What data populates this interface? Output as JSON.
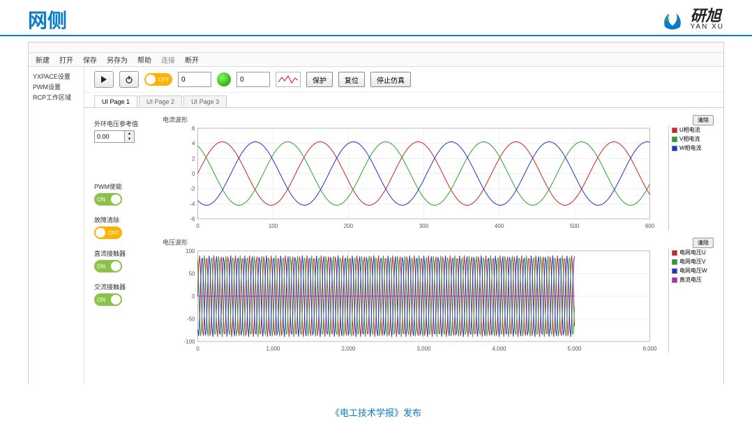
{
  "page_title": "网侧",
  "brand": {
    "cn": "研旭",
    "en": "YAN XU"
  },
  "menubar": [
    "新建",
    "打开",
    "保存",
    "另存为",
    "帮助",
    "连接",
    "断开"
  ],
  "sidebar": [
    "YXPACE设置",
    "PWM设置",
    "RCP工作区域"
  ],
  "toolbar": {
    "toggle1": "OFF",
    "num1": "0",
    "num2": "0",
    "btn_protect": "保护",
    "btn_reset": "复位",
    "btn_stop": "停止仿真"
  },
  "tabs": [
    "UI Page 1",
    "UI Page 2",
    "UI Page 3"
  ],
  "controls": {
    "ref_label": "外环电压参考值",
    "ref_value": "0.00",
    "sw1": {
      "label": "PWM使能",
      "state": "ON"
    },
    "sw2": {
      "label": "故障清除",
      "state": "OFF"
    },
    "sw3": {
      "label": "直流接触器",
      "state": "ON"
    },
    "sw4": {
      "label": "交流接触器",
      "state": "ON"
    }
  },
  "chart_data": [
    {
      "type": "line",
      "title": "电流波形",
      "xlim": [
        0,
        600
      ],
      "ylim": [
        -6,
        6
      ],
      "xticks": [
        0,
        100,
        200,
        300,
        400,
        500,
        600
      ],
      "yticks": [
        -6,
        -4,
        -2,
        0,
        2,
        4,
        6
      ],
      "btn": "清除",
      "series": [
        {
          "name": "U相电流",
          "color": "#d42020",
          "amp": 4.2,
          "period": 130,
          "phase": 0
        },
        {
          "name": "V相电流",
          "color": "#29a329",
          "amp": 4.2,
          "period": 130,
          "phase": 43
        },
        {
          "name": "W相电流",
          "color": "#2030d4",
          "amp": 4.2,
          "period": 130,
          "phase": 86
        }
      ]
    },
    {
      "type": "line",
      "title": "电压波形",
      "xlim": [
        0,
        6000
      ],
      "ylim": [
        -100,
        100
      ],
      "xticks": [
        0,
        1000,
        2000,
        3000,
        4000,
        5000,
        6000
      ],
      "yticks": [
        -100,
        -50,
        0,
        50,
        100
      ],
      "btn": "清除",
      "series": [
        {
          "name": "电网电压U",
          "color": "#d42020",
          "amp": 90,
          "period": 95,
          "phase": 0,
          "xmax": 5000
        },
        {
          "name": "电网电压V",
          "color": "#29a329",
          "amp": 90,
          "period": 95,
          "phase": 31,
          "xmax": 5000
        },
        {
          "name": "电网电压W",
          "color": "#2030d4",
          "amp": 90,
          "period": 95,
          "phase": 62,
          "xmax": 5000
        },
        {
          "name": "直流电压",
          "color": "#c020c0",
          "amp": 0,
          "offset": 0,
          "period": 1000,
          "phase": 0,
          "xmax": 5000
        }
      ]
    }
  ],
  "footer": "《电工技术学报》发布"
}
